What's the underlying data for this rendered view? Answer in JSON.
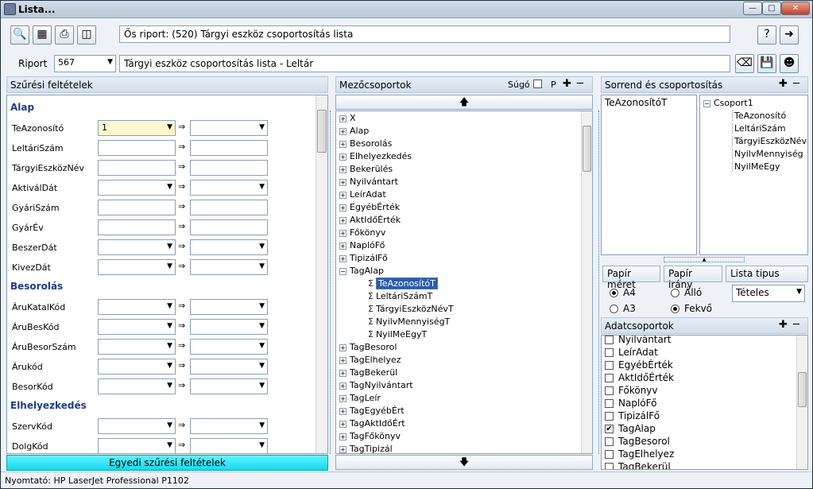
{
  "window": {
    "title": "Lista..."
  },
  "header": {
    "parent_report": "Ős riport: (520)  Tárgyi eszköz csoportosítás lista"
  },
  "report": {
    "label": "Riport",
    "id": "567",
    "name": "Tárgyi eszköz csoportosítás lista - Leltár"
  },
  "filters": {
    "title": "Szűrési feltételek",
    "custom_button": "Egyedi szűrési feltételek",
    "groups": [
      {
        "name": "Alap",
        "rows": [
          {
            "label": "TeAzonosító",
            "from": "1",
            "from_dropdown": true,
            "to_dropdown": true
          },
          {
            "label": "LeltáriSzám",
            "from": "",
            "from_dropdown": false,
            "to_dropdown": false
          },
          {
            "label": "TárgyiEszközNév",
            "from": "",
            "from_dropdown": false,
            "to_dropdown": false
          },
          {
            "label": "AktiválDát",
            "from": "",
            "from_dropdown": true,
            "to_dropdown": true
          },
          {
            "label": "GyáriSzám",
            "from": "",
            "from_dropdown": false,
            "to_dropdown": false
          },
          {
            "label": "GyárÉv",
            "from": "",
            "from_dropdown": false,
            "to_dropdown": false
          },
          {
            "label": "BeszerDát",
            "from": "",
            "from_dropdown": true,
            "to_dropdown": true
          },
          {
            "label": "KivezDát",
            "from": "",
            "from_dropdown": true,
            "to_dropdown": true
          }
        ]
      },
      {
        "name": "Besorolás",
        "rows": [
          {
            "label": "ÁruKatalKód",
            "from": "",
            "from_dropdown": true,
            "to_dropdown": true
          },
          {
            "label": "ÁruBesKód",
            "from": "",
            "from_dropdown": true,
            "to_dropdown": true
          },
          {
            "label": "ÁruBesorSzám",
            "from": "",
            "from_dropdown": true,
            "to_dropdown": true
          },
          {
            "label": "Árukód",
            "from": "",
            "from_dropdown": true,
            "to_dropdown": true
          },
          {
            "label": "BesorKód",
            "from": "",
            "from_dropdown": true,
            "to_dropdown": true
          }
        ]
      },
      {
        "name": "Elhelyezkedés",
        "rows": [
          {
            "label": "SzervKód",
            "from": "",
            "from_dropdown": true,
            "to_dropdown": true
          },
          {
            "label": "DolgKód",
            "from": "",
            "from_dropdown": true,
            "to_dropdown": true
          }
        ]
      }
    ]
  },
  "fields": {
    "title": "Mezőcsoportok",
    "help_label": "Súgó",
    "p_label": "P",
    "tree": [
      {
        "label": "X",
        "expanded": false
      },
      {
        "label": "Alap",
        "expanded": false
      },
      {
        "label": "Besorolás",
        "expanded": false
      },
      {
        "label": "Elhelyezkedés",
        "expanded": false
      },
      {
        "label": "Bekerülés",
        "expanded": false
      },
      {
        "label": "Nyilvántart",
        "expanded": false
      },
      {
        "label": "LeírAdat",
        "expanded": false
      },
      {
        "label": "EgyébÉrték",
        "expanded": false
      },
      {
        "label": "AktIdőÉrték",
        "expanded": false
      },
      {
        "label": "Főkönyv",
        "expanded": false
      },
      {
        "label": "NaplóFő",
        "expanded": false
      },
      {
        "label": "TipizálFő",
        "expanded": false
      },
      {
        "label": "TagAlap",
        "expanded": true,
        "children": [
          {
            "label": "TeAzonosítóT",
            "selected": true
          },
          {
            "label": "LeltáriSzámT",
            "selected": false
          },
          {
            "label": "TárgyiEszközNévT",
            "selected": false
          },
          {
            "label": "NyilvMennyiségT",
            "selected": false
          },
          {
            "label": "NyilMeEgyT",
            "selected": false
          }
        ]
      },
      {
        "label": "TagBesorol",
        "expanded": false
      },
      {
        "label": "TagElhelyez",
        "expanded": false
      },
      {
        "label": "TagBekerül",
        "expanded": false
      },
      {
        "label": "TagNyilvántart",
        "expanded": false
      },
      {
        "label": "TagLeír",
        "expanded": false
      },
      {
        "label": "TagEgyébÉrt",
        "expanded": false
      },
      {
        "label": "TagAktIdőÉrt",
        "expanded": false
      },
      {
        "label": "TagFőkönyv",
        "expanded": false
      },
      {
        "label": "TagTipizál",
        "expanded": false
      }
    ]
  },
  "sorting": {
    "title": "Sorrend és csoportosítás",
    "order_items": [
      "TeAzonosítóT"
    ],
    "group_root": "Csoport1",
    "group_items": [
      "TeAzonosító",
      "LeltáriSzám",
      "TárgyiEszközNév",
      "NyilvMennyiség",
      "NyilMeEgy"
    ]
  },
  "print": {
    "paper_size_label": "Papír méret",
    "paper_dir_label": "Papír irány",
    "list_type_label": "Lista tipus",
    "sizes": [
      {
        "label": "A4",
        "selected": true
      },
      {
        "label": "A3",
        "selected": false
      }
    ],
    "dirs": [
      {
        "label": "Álló",
        "selected": false
      },
      {
        "label": "Fekvő",
        "selected": true
      }
    ],
    "list_type_value": "Tételes"
  },
  "datagroups": {
    "title": "Adatcsoportok",
    "items": [
      {
        "label": "Nyilvántart",
        "checked": false
      },
      {
        "label": "LeírAdat",
        "checked": false
      },
      {
        "label": "EgyébÉrték",
        "checked": false
      },
      {
        "label": "AktIdőÉrték",
        "checked": false
      },
      {
        "label": "Főkönyv",
        "checked": false
      },
      {
        "label": "NaplóFő",
        "checked": false
      },
      {
        "label": "TipizálFő",
        "checked": false
      },
      {
        "label": "TagAlap",
        "checked": true
      },
      {
        "label": "TagBesorol",
        "checked": false
      },
      {
        "label": "TagElhelyez",
        "checked": false
      },
      {
        "label": "TagBekerül",
        "checked": false
      }
    ]
  },
  "status": {
    "printer": "Nyomtató: HP LaserJet Professional P1102"
  }
}
